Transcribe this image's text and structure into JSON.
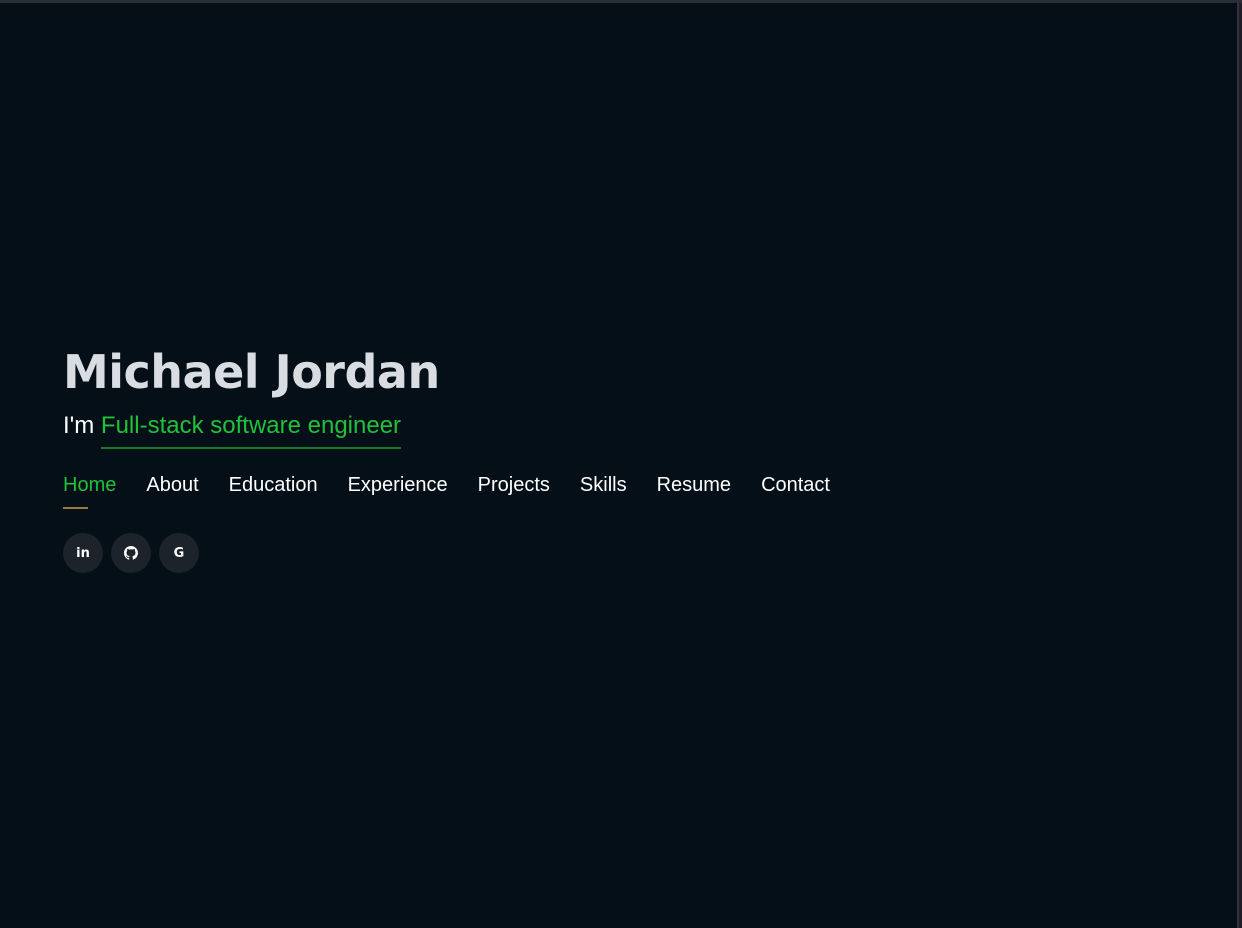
{
  "hero": {
    "name": "Michael Jordan",
    "prefix": "I'm ",
    "role": "Full-stack software engineer"
  },
  "nav": {
    "items": [
      {
        "label": "Home",
        "active": true
      },
      {
        "label": "About"
      },
      {
        "label": "Education"
      },
      {
        "label": "Experience"
      },
      {
        "label": "Projects"
      },
      {
        "label": "Skills"
      },
      {
        "label": "Resume"
      },
      {
        "label": "Contact"
      }
    ]
  },
  "socials": [
    {
      "icon": "linkedin-icon",
      "glyph": "in"
    },
    {
      "icon": "github-icon"
    },
    {
      "icon": "google-icon",
      "glyph": "G"
    }
  ],
  "colors": {
    "background": "#040f18",
    "accent": "#1fc23a",
    "name": "#d9dde2",
    "indicator": "#9a7a3a"
  }
}
